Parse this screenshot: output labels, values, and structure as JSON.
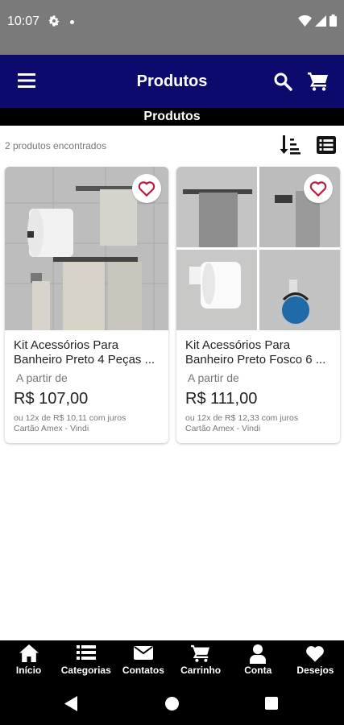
{
  "status_bar": {
    "time": "10:07"
  },
  "app_bar": {
    "title": "Produtos"
  },
  "section": {
    "title": "Produtos"
  },
  "results": {
    "count_text": "2 produtos encontrados"
  },
  "products": [
    {
      "name": "Kit Acessórios Para Banheiro Preto 4 Peças ...",
      "from_label": "A partir de",
      "price": "R$ 107,00",
      "installments_line1": "ou 12x de R$ 10,11 com juros",
      "installments_line2": "Cartão Amex - Vindi"
    },
    {
      "name": "Kit Acessórios Para Banheiro Preto Fosco 6 ...",
      "from_label": "A partir de",
      "price": "R$ 111,00",
      "installments_line1": "ou 12x de R$ 12,33 com juros",
      "installments_line2": "Cartão Amex - Vindi"
    }
  ],
  "bottom_nav": [
    {
      "label": "Início",
      "icon": "home-icon"
    },
    {
      "label": "Categorias",
      "icon": "list-icon"
    },
    {
      "label": "Contatos",
      "icon": "mail-icon"
    },
    {
      "label": "Carrinho",
      "icon": "cart-icon"
    },
    {
      "label": "Conta",
      "icon": "user-icon"
    },
    {
      "label": "Desejos",
      "icon": "heart-icon"
    }
  ],
  "colors": {
    "app_bar": "#0d0a6e",
    "status_bar": "#7a7a7a",
    "nav_bar": "#000000",
    "favorite": "#c0183a"
  }
}
